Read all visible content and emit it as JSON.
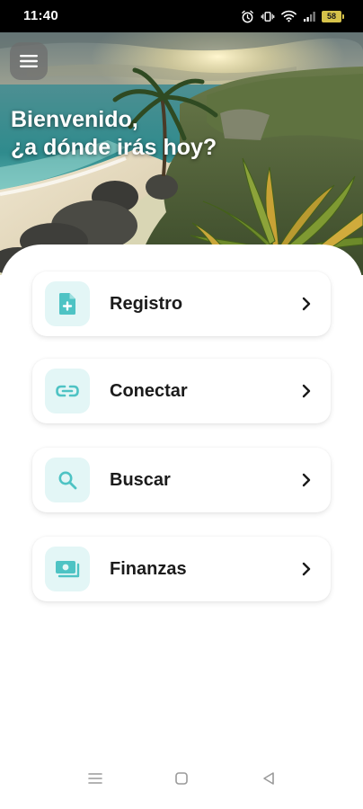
{
  "status_bar": {
    "time": "11:40",
    "battery": "58",
    "icons": [
      "alarm-icon",
      "vibrate-icon",
      "wifi-icon",
      "signal-icon",
      "battery-icon"
    ]
  },
  "header": {
    "menu_icon": "hamburger-menu-icon",
    "greeting_line1": "Bienvenido,",
    "greeting_line2": "¿a dónde irás hoy?"
  },
  "menu": {
    "items": [
      {
        "label": "Registro",
        "icon": "document-add-icon"
      },
      {
        "label": "Conectar",
        "icon": "link-icon"
      },
      {
        "label": "Buscar",
        "icon": "search-icon"
      },
      {
        "label": "Finanzas",
        "icon": "money-icon"
      }
    ]
  },
  "nav_bar": {
    "icons": [
      "recent-apps-icon",
      "home-icon",
      "back-icon"
    ]
  },
  "colors": {
    "accent": "#4ec3c4",
    "icon_background": "#e3f6f6",
    "text": "#1b1b1b"
  }
}
